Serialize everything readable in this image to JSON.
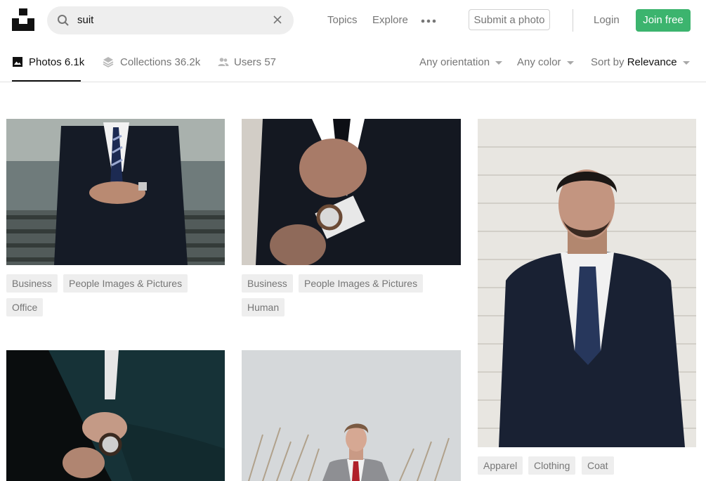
{
  "search": {
    "query": "suit"
  },
  "nav": {
    "topics": "Topics",
    "explore": "Explore"
  },
  "actions": {
    "submit": "Submit a photo",
    "login": "Login",
    "join": "Join free"
  },
  "tabs": [
    {
      "label": "Photos 6.1k",
      "icon": "image-icon",
      "active": true
    },
    {
      "label": "Collections 36.2k",
      "icon": "stack-icon",
      "active": false
    },
    {
      "label": "Users 57",
      "icon": "users-icon",
      "active": false
    }
  ],
  "filters": {
    "orientation": "Any orientation",
    "color": "Any color",
    "sort_prefix": "Sort by",
    "sort_value": "Relevance"
  },
  "photos": [
    {
      "tags": [
        "Business",
        "People Images & Pictures",
        "Office"
      ]
    },
    {
      "tags": [
        "Business",
        "People Images & Pictures",
        "Human"
      ]
    },
    {
      "tags": [
        "Apparel",
        "Clothing",
        "Coat"
      ]
    },
    {
      "tags": []
    },
    {
      "tags": []
    }
  ],
  "colors": {
    "brand_green": "#3cb46e",
    "text_muted": "#767676",
    "tag_bg": "#eeeeee"
  }
}
